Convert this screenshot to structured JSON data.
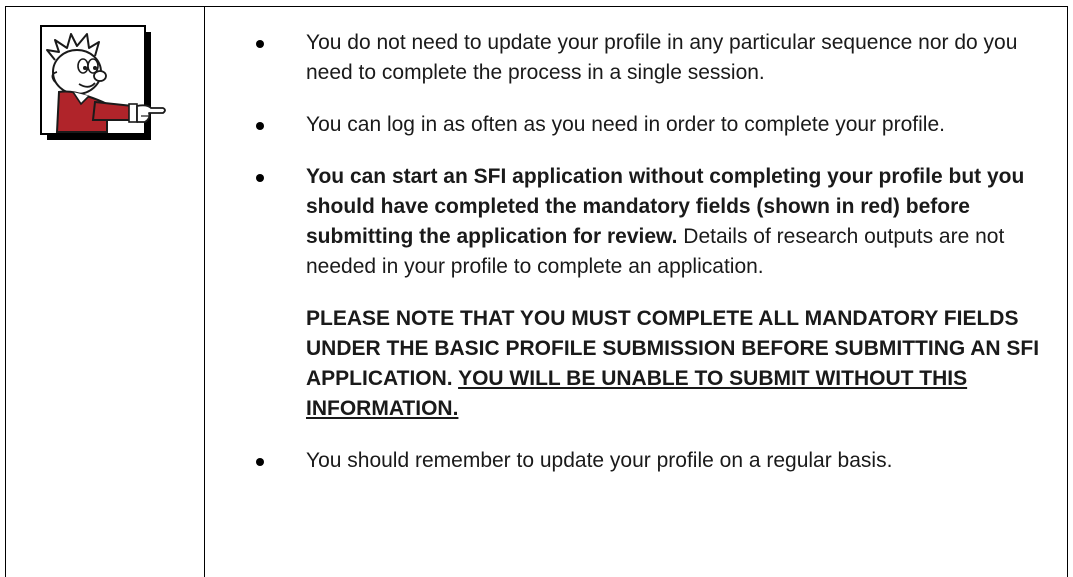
{
  "bullets": [
    {
      "text": "You do not need to update your profile in any particular sequence nor do you need to complete the process in a single session."
    },
    {
      "text": "You can log in as often as you need in order to complete your profile."
    },
    {
      "bold_text": "You can start an SFI application without completing your profile but you should have completed the mandatory fields (shown in red) before submitting the application for review.",
      "text": " Details of research outputs are not needed in your profile to complete an application."
    },
    {
      "text": "You should remember to update your profile on a regular basis."
    }
  ],
  "note": {
    "text": "PLEASE NOTE THAT YOU MUST COMPLETE ALL MANDATORY FIELDS UNDER THE BASIC PROFILE SUBMISSION BEFORE SUBMITTING AN SFI APPLICATION. ",
    "underlined": "YOU WILL BE UNABLE TO SUBMIT WITHOUT THIS INFORMATION."
  },
  "icon": {
    "name": "pointing-character-icon",
    "colors": {
      "jacket": "#b0242a",
      "outline": "#1a1a1a",
      "box_shadow": "#000000"
    }
  }
}
